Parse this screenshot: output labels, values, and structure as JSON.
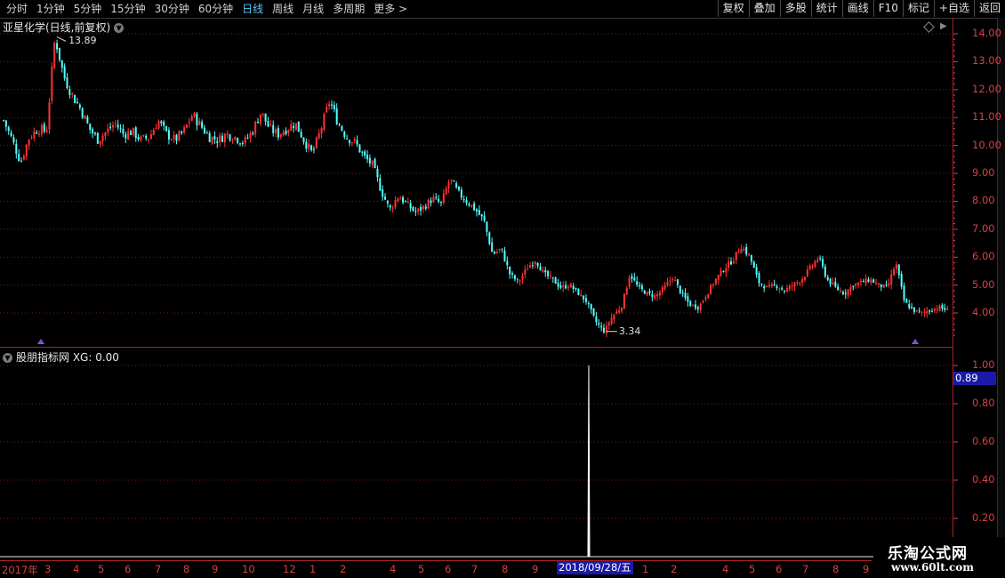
{
  "toolbar": {
    "periods": [
      "分时",
      "1分钟",
      "5分钟",
      "15分钟",
      "30分钟",
      "60分钟",
      "日线",
      "周线",
      "月线",
      "多周期",
      "更多 >"
    ],
    "active_period": "日线",
    "buttons": [
      "复权",
      "叠加",
      "多股",
      "统计",
      "画线",
      "F10",
      "标记",
      "+自选",
      "返回"
    ]
  },
  "stock": {
    "title": "亚星化学(日线,前复权)"
  },
  "price_axis": {
    "ticks": [
      "14.00",
      "13.00",
      "12.00",
      "11.00",
      "10.00",
      "9.00",
      "8.00",
      "7.00",
      "6.00",
      "5.00",
      "4.00"
    ]
  },
  "annotations": {
    "high": "13.89",
    "low": "3.34"
  },
  "indicator": {
    "title": "股朋指标网 XG: 0.00",
    "current_value": "0.89",
    "ticks": [
      "1.00",
      "0.80",
      "0.60",
      "0.40",
      "0.20"
    ]
  },
  "date_axis": {
    "labels": [
      "2017年",
      "3",
      "4",
      "5",
      "6",
      "7",
      "8",
      "9",
      "10",
      "12",
      "1",
      "2",
      "4",
      "5",
      "6",
      "7",
      "8",
      "9",
      "1",
      "2",
      "4",
      "5",
      "6",
      "7",
      "8",
      "9"
    ],
    "selected": "2018/09/28/五"
  },
  "watermark": {
    "title": "乐淘公式网",
    "url": "www.60lt.com"
  },
  "colors": {
    "up": "#ff3232",
    "down": "#54ffff",
    "grid": "#7a1a1a",
    "axis": "#d84040",
    "highlight": "#1a1aa8"
  },
  "chart_data": {
    "type": "candlestick",
    "title": "亚星化学(日线,前复权)",
    "ylim": [
      3.0,
      14.5
    ],
    "high_marker": 13.89,
    "low_marker": 3.34,
    "close_path": [
      10.9,
      10.2,
      9.4,
      10.3,
      10.6,
      10.5,
      13.89,
      12.5,
      11.8,
      11.3,
      10.6,
      10.2,
      10.5,
      10.8,
      10.4,
      10.5,
      10.2,
      10.3,
      10.9,
      10.4,
      10.2,
      10.5,
      11.1,
      10.7,
      10.3,
      10.2,
      10.4,
      10.3,
      10.1,
      10.5,
      11.2,
      10.6,
      10.4,
      10.6,
      10.8,
      10.2,
      9.7,
      10.6,
      11.6,
      10.8,
      10.3,
      10.1,
      9.6,
      9.3,
      8.4,
      7.7,
      8.2,
      7.9,
      7.6,
      7.8,
      8.1,
      7.9,
      8.8,
      8.3,
      8.0,
      7.7,
      7.3,
      6.1,
      6.3,
      5.4,
      5.1,
      5.6,
      5.9,
      5.4,
      5.2,
      4.9,
      5.0,
      4.7,
      4.4,
      3.7,
      3.34,
      3.9,
      4.2,
      5.4,
      4.9,
      4.7,
      4.6,
      4.9,
      5.3,
      4.7,
      4.3,
      4.2,
      4.7,
      5.2,
      5.6,
      5.9,
      6.4,
      6.0,
      5.1,
      4.9,
      5.0,
      4.8,
      5.0,
      5.2,
      5.6,
      6.0,
      5.2,
      4.9,
      4.7,
      5.0,
      5.1,
      5.2,
      5.0,
      4.9,
      5.8,
      4.4,
      4.1,
      4.0,
      4.1,
      4.2,
      4.1
    ],
    "xg_signal": {
      "date": "2018/09/28",
      "value": 1.0
    },
    "xg_current": 0.0,
    "indicator_ylim": [
      0,
      1.05
    ]
  }
}
